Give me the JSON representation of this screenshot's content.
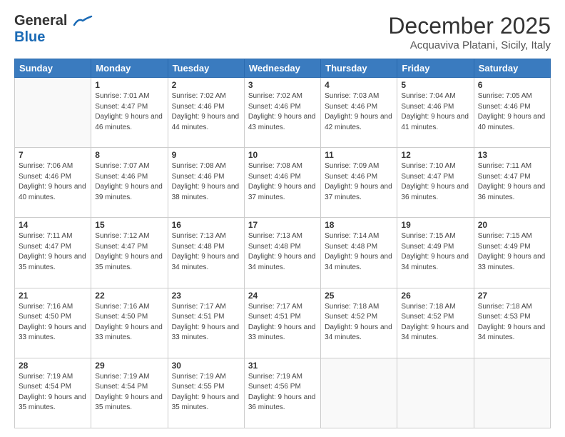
{
  "logo": {
    "line1": "General",
    "line2": "Blue"
  },
  "title": "December 2025",
  "location": "Acquaviva Platani, Sicily, Italy",
  "days_of_week": [
    "Sunday",
    "Monday",
    "Tuesday",
    "Wednesday",
    "Thursday",
    "Friday",
    "Saturday"
  ],
  "weeks": [
    [
      {
        "day": "",
        "sunrise": "",
        "sunset": "",
        "daylight": ""
      },
      {
        "day": "1",
        "sunrise": "Sunrise: 7:01 AM",
        "sunset": "Sunset: 4:47 PM",
        "daylight": "Daylight: 9 hours and 46 minutes."
      },
      {
        "day": "2",
        "sunrise": "Sunrise: 7:02 AM",
        "sunset": "Sunset: 4:46 PM",
        "daylight": "Daylight: 9 hours and 44 minutes."
      },
      {
        "day": "3",
        "sunrise": "Sunrise: 7:02 AM",
        "sunset": "Sunset: 4:46 PM",
        "daylight": "Daylight: 9 hours and 43 minutes."
      },
      {
        "day": "4",
        "sunrise": "Sunrise: 7:03 AM",
        "sunset": "Sunset: 4:46 PM",
        "daylight": "Daylight: 9 hours and 42 minutes."
      },
      {
        "day": "5",
        "sunrise": "Sunrise: 7:04 AM",
        "sunset": "Sunset: 4:46 PM",
        "daylight": "Daylight: 9 hours and 41 minutes."
      },
      {
        "day": "6",
        "sunrise": "Sunrise: 7:05 AM",
        "sunset": "Sunset: 4:46 PM",
        "daylight": "Daylight: 9 hours and 40 minutes."
      }
    ],
    [
      {
        "day": "7",
        "sunrise": "Sunrise: 7:06 AM",
        "sunset": "Sunset: 4:46 PM",
        "daylight": "Daylight: 9 hours and 40 minutes."
      },
      {
        "day": "8",
        "sunrise": "Sunrise: 7:07 AM",
        "sunset": "Sunset: 4:46 PM",
        "daylight": "Daylight: 9 hours and 39 minutes."
      },
      {
        "day": "9",
        "sunrise": "Sunrise: 7:08 AM",
        "sunset": "Sunset: 4:46 PM",
        "daylight": "Daylight: 9 hours and 38 minutes."
      },
      {
        "day": "10",
        "sunrise": "Sunrise: 7:08 AM",
        "sunset": "Sunset: 4:46 PM",
        "daylight": "Daylight: 9 hours and 37 minutes."
      },
      {
        "day": "11",
        "sunrise": "Sunrise: 7:09 AM",
        "sunset": "Sunset: 4:46 PM",
        "daylight": "Daylight: 9 hours and 37 minutes."
      },
      {
        "day": "12",
        "sunrise": "Sunrise: 7:10 AM",
        "sunset": "Sunset: 4:47 PM",
        "daylight": "Daylight: 9 hours and 36 minutes."
      },
      {
        "day": "13",
        "sunrise": "Sunrise: 7:11 AM",
        "sunset": "Sunset: 4:47 PM",
        "daylight": "Daylight: 9 hours and 36 minutes."
      }
    ],
    [
      {
        "day": "14",
        "sunrise": "Sunrise: 7:11 AM",
        "sunset": "Sunset: 4:47 PM",
        "daylight": "Daylight: 9 hours and 35 minutes."
      },
      {
        "day": "15",
        "sunrise": "Sunrise: 7:12 AM",
        "sunset": "Sunset: 4:47 PM",
        "daylight": "Daylight: 9 hours and 35 minutes."
      },
      {
        "day": "16",
        "sunrise": "Sunrise: 7:13 AM",
        "sunset": "Sunset: 4:48 PM",
        "daylight": "Daylight: 9 hours and 34 minutes."
      },
      {
        "day": "17",
        "sunrise": "Sunrise: 7:13 AM",
        "sunset": "Sunset: 4:48 PM",
        "daylight": "Daylight: 9 hours and 34 minutes."
      },
      {
        "day": "18",
        "sunrise": "Sunrise: 7:14 AM",
        "sunset": "Sunset: 4:48 PM",
        "daylight": "Daylight: 9 hours and 34 minutes."
      },
      {
        "day": "19",
        "sunrise": "Sunrise: 7:15 AM",
        "sunset": "Sunset: 4:49 PM",
        "daylight": "Daylight: 9 hours and 34 minutes."
      },
      {
        "day": "20",
        "sunrise": "Sunrise: 7:15 AM",
        "sunset": "Sunset: 4:49 PM",
        "daylight": "Daylight: 9 hours and 33 minutes."
      }
    ],
    [
      {
        "day": "21",
        "sunrise": "Sunrise: 7:16 AM",
        "sunset": "Sunset: 4:50 PM",
        "daylight": "Daylight: 9 hours and 33 minutes."
      },
      {
        "day": "22",
        "sunrise": "Sunrise: 7:16 AM",
        "sunset": "Sunset: 4:50 PM",
        "daylight": "Daylight: 9 hours and 33 minutes."
      },
      {
        "day": "23",
        "sunrise": "Sunrise: 7:17 AM",
        "sunset": "Sunset: 4:51 PM",
        "daylight": "Daylight: 9 hours and 33 minutes."
      },
      {
        "day": "24",
        "sunrise": "Sunrise: 7:17 AM",
        "sunset": "Sunset: 4:51 PM",
        "daylight": "Daylight: 9 hours and 33 minutes."
      },
      {
        "day": "25",
        "sunrise": "Sunrise: 7:18 AM",
        "sunset": "Sunset: 4:52 PM",
        "daylight": "Daylight: 9 hours and 34 minutes."
      },
      {
        "day": "26",
        "sunrise": "Sunrise: 7:18 AM",
        "sunset": "Sunset: 4:52 PM",
        "daylight": "Daylight: 9 hours and 34 minutes."
      },
      {
        "day": "27",
        "sunrise": "Sunrise: 7:18 AM",
        "sunset": "Sunset: 4:53 PM",
        "daylight": "Daylight: 9 hours and 34 minutes."
      }
    ],
    [
      {
        "day": "28",
        "sunrise": "Sunrise: 7:19 AM",
        "sunset": "Sunset: 4:54 PM",
        "daylight": "Daylight: 9 hours and 35 minutes."
      },
      {
        "day": "29",
        "sunrise": "Sunrise: 7:19 AM",
        "sunset": "Sunset: 4:54 PM",
        "daylight": "Daylight: 9 hours and 35 minutes."
      },
      {
        "day": "30",
        "sunrise": "Sunrise: 7:19 AM",
        "sunset": "Sunset: 4:55 PM",
        "daylight": "Daylight: 9 hours and 35 minutes."
      },
      {
        "day": "31",
        "sunrise": "Sunrise: 7:19 AM",
        "sunset": "Sunset: 4:56 PM",
        "daylight": "Daylight: 9 hours and 36 minutes."
      },
      {
        "day": "",
        "sunrise": "",
        "sunset": "",
        "daylight": ""
      },
      {
        "day": "",
        "sunrise": "",
        "sunset": "",
        "daylight": ""
      },
      {
        "day": "",
        "sunrise": "",
        "sunset": "",
        "daylight": ""
      }
    ]
  ]
}
